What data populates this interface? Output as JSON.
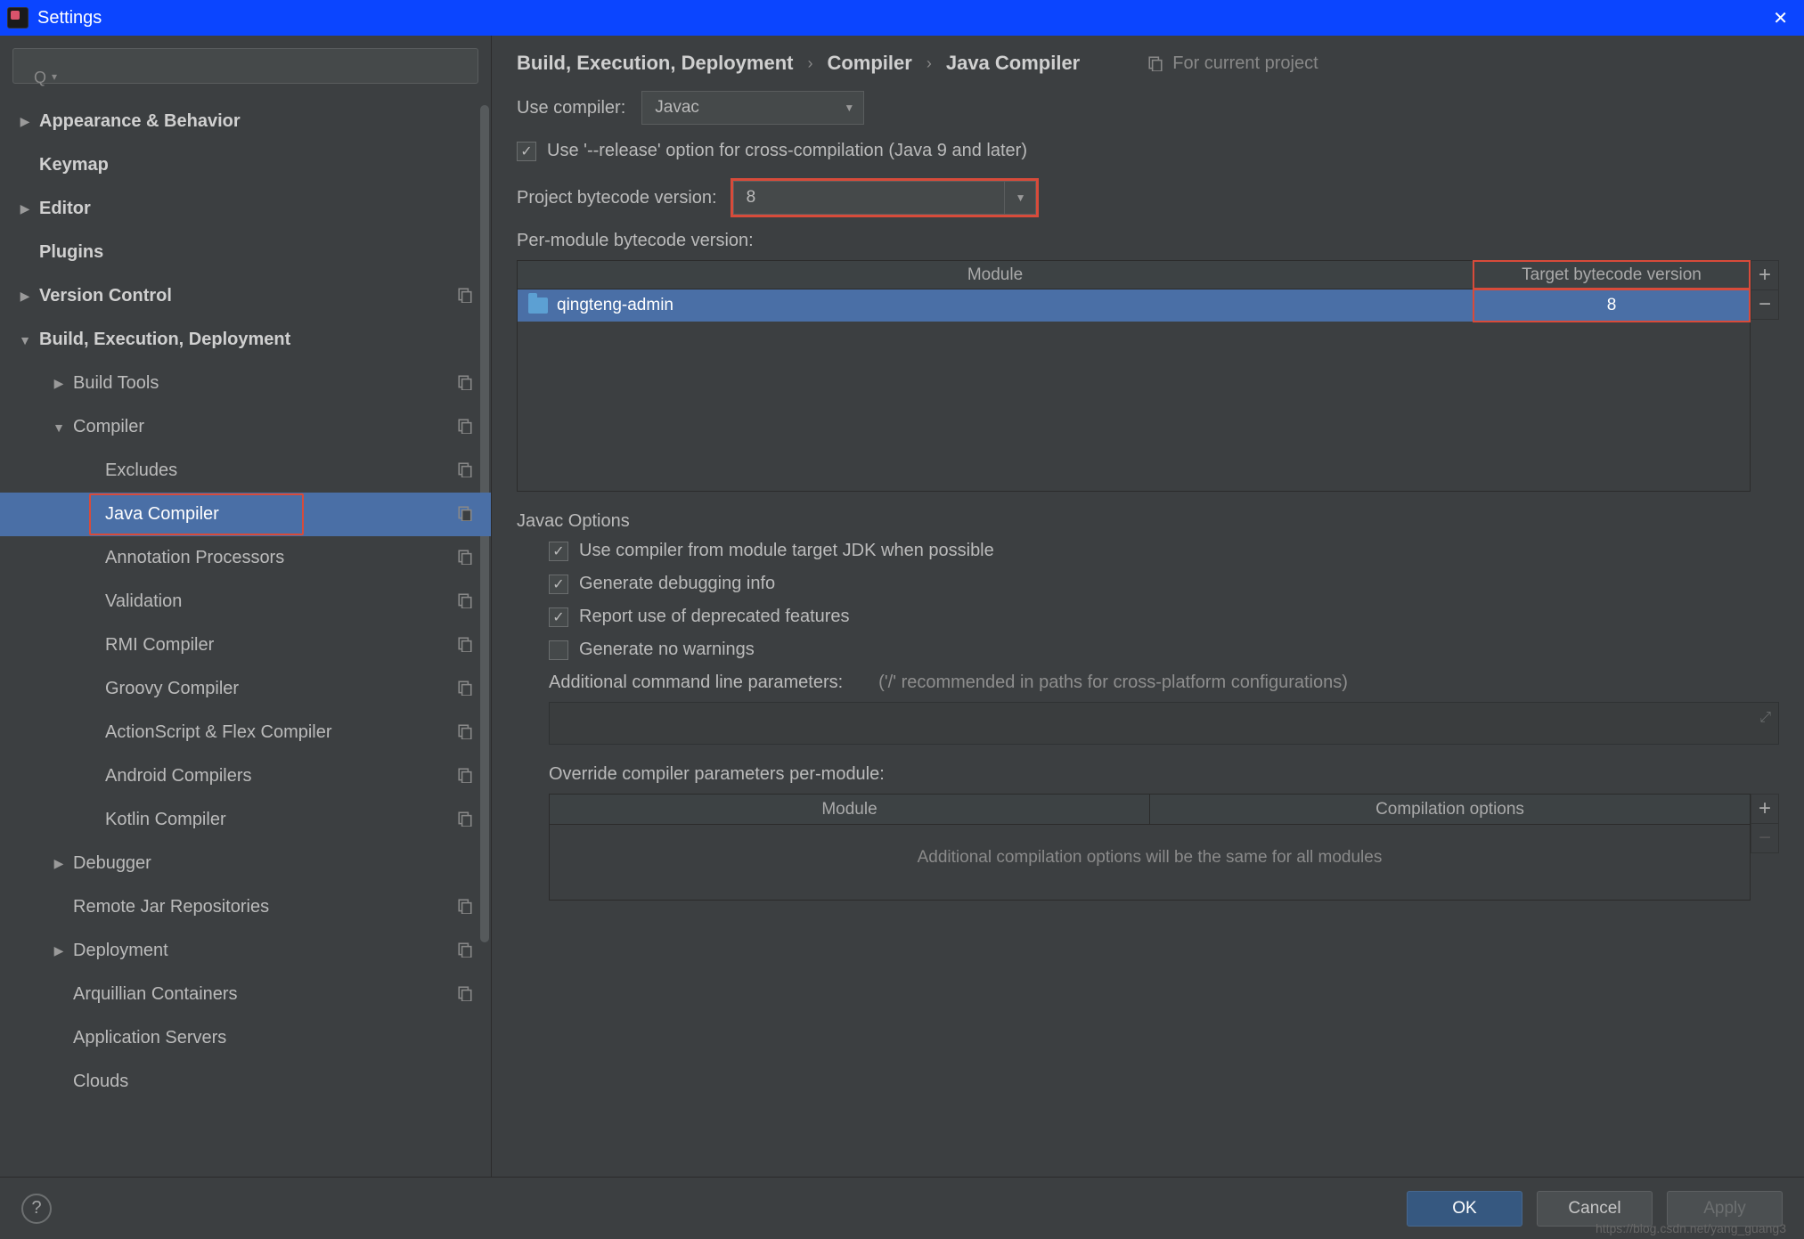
{
  "window": {
    "title": "Settings"
  },
  "search": {
    "placeholder": ""
  },
  "sidebar": {
    "items": [
      {
        "label": "Appearance & Behavior",
        "depth": 0,
        "caret": "right",
        "bold": true
      },
      {
        "label": "Keymap",
        "depth": 0,
        "caret": "none",
        "bold": true
      },
      {
        "label": "Editor",
        "depth": 0,
        "caret": "right",
        "bold": true
      },
      {
        "label": "Plugins",
        "depth": 0,
        "caret": "none",
        "bold": true
      },
      {
        "label": "Version Control",
        "depth": 0,
        "caret": "right",
        "bold": true,
        "copy": true
      },
      {
        "label": "Build, Execution, Deployment",
        "depth": 0,
        "caret": "down",
        "bold": true
      },
      {
        "label": "Build Tools",
        "depth": 1,
        "caret": "right",
        "copy": true
      },
      {
        "label": "Compiler",
        "depth": 1,
        "caret": "down",
        "copy": true
      },
      {
        "label": "Excludes",
        "depth": 2,
        "caret": "none",
        "copy": true
      },
      {
        "label": "Java Compiler",
        "depth": 2,
        "caret": "none",
        "selected": true,
        "copy": true,
        "redbox": true
      },
      {
        "label": "Annotation Processors",
        "depth": 2,
        "caret": "none",
        "copy": true
      },
      {
        "label": "Validation",
        "depth": 2,
        "caret": "none",
        "copy": true
      },
      {
        "label": "RMI Compiler",
        "depth": 2,
        "caret": "none",
        "copy": true
      },
      {
        "label": "Groovy Compiler",
        "depth": 2,
        "caret": "none",
        "copy": true
      },
      {
        "label": "ActionScript & Flex Compiler",
        "depth": 2,
        "caret": "none",
        "copy": true
      },
      {
        "label": "Android Compilers",
        "depth": 2,
        "caret": "none",
        "copy": true
      },
      {
        "label": "Kotlin Compiler",
        "depth": 2,
        "caret": "none",
        "copy": true
      },
      {
        "label": "Debugger",
        "depth": 1,
        "caret": "right"
      },
      {
        "label": "Remote Jar Repositories",
        "depth": 1,
        "caret": "none",
        "copy": true
      },
      {
        "label": "Deployment",
        "depth": 1,
        "caret": "right",
        "copy": true
      },
      {
        "label": "Arquillian Containers",
        "depth": 1,
        "caret": "none",
        "copy": true
      },
      {
        "label": "Application Servers",
        "depth": 1,
        "caret": "none"
      },
      {
        "label": "Clouds",
        "depth": 1,
        "caret": "none"
      }
    ]
  },
  "breadcrumb": {
    "a": "Build, Execution, Deployment",
    "b": "Compiler",
    "c": "Java Compiler",
    "hint": "For current project"
  },
  "form": {
    "use_compiler_label": "Use compiler:",
    "use_compiler_value": "Javac",
    "release_option": "Use '--release' option for cross-compilation (Java 9 and later)",
    "project_bytecode_label": "Project bytecode version:",
    "project_bytecode_value": "8",
    "per_module_label": "Per-module bytecode version:",
    "table": {
      "col_module": "Module",
      "col_target": "Target bytecode version",
      "rows": [
        {
          "module": "qingteng-admin",
          "target": "8"
        }
      ]
    }
  },
  "javac": {
    "title": "Javac Options",
    "opt1": "Use compiler from module target JDK when possible",
    "opt2": "Generate debugging info",
    "opt3": "Report use of deprecated features",
    "opt4": "Generate no warnings",
    "addl_label": "Additional command line parameters:",
    "addl_hint": "('/' recommended in paths for cross-platform configurations)",
    "override_label": "Override compiler parameters per-module:",
    "override_cols": {
      "module": "Module",
      "opts": "Compilation options"
    },
    "override_empty": "Additional compilation options will be the same for all modules"
  },
  "footer": {
    "ok": "OK",
    "cancel": "Cancel",
    "apply": "Apply"
  },
  "watermark": "https://blog.csdn.net/yang_guang3"
}
